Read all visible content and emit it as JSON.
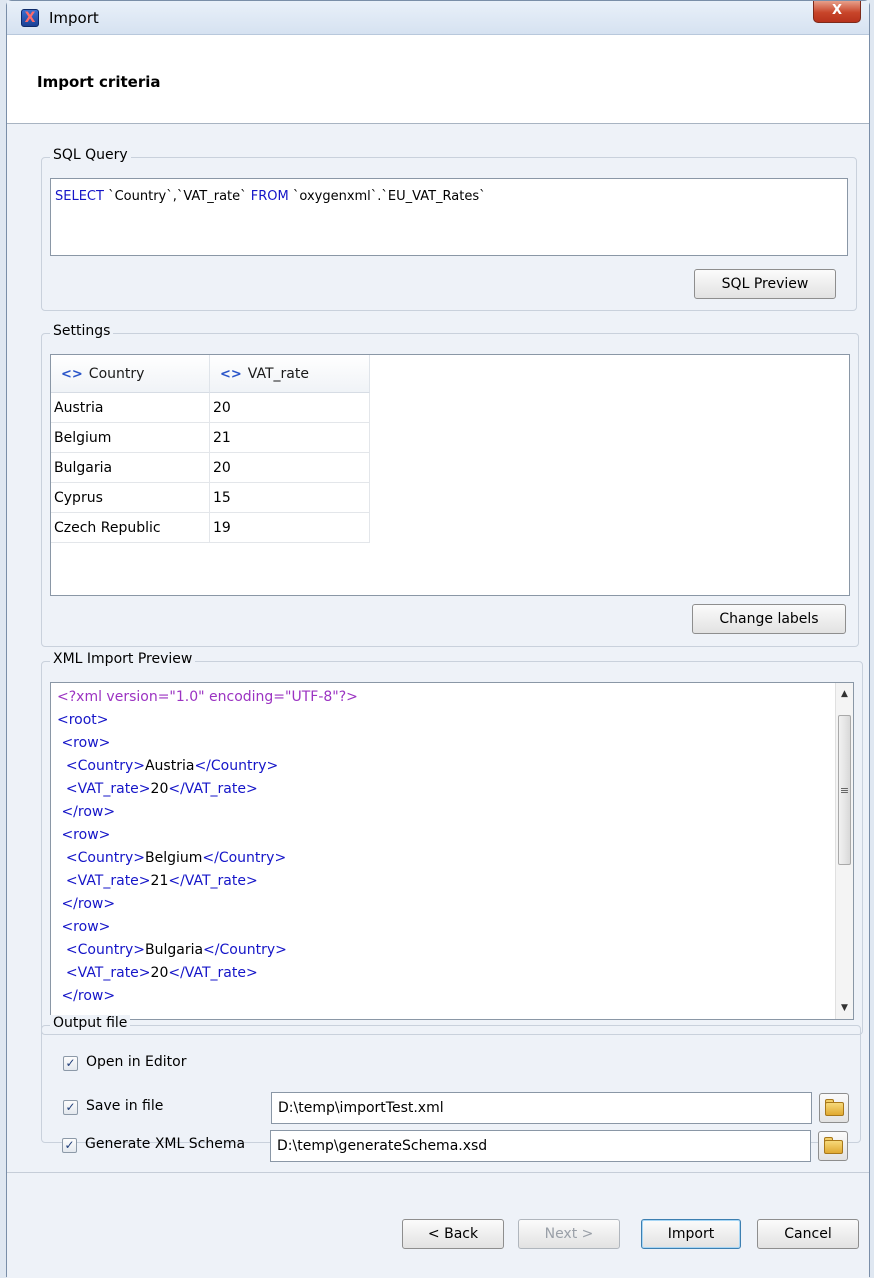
{
  "window": {
    "title": "Import",
    "close_glyph": "X"
  },
  "header": {
    "title": "Import criteria"
  },
  "sql_query": {
    "legend": "SQL Query",
    "query_parts": [
      "SELECT",
      " `Country`,`VAT_rate` ",
      "FROM",
      " `oxygenxml`.`EU_VAT_Rates`"
    ],
    "preview_button": "SQL Preview"
  },
  "settings": {
    "legend": "Settings",
    "columns": [
      "Country",
      "VAT_rate"
    ],
    "rows": [
      [
        "Austria",
        "20"
      ],
      [
        "Belgium",
        "21"
      ],
      [
        "Bulgaria",
        "20"
      ],
      [
        "Cyprus",
        "15"
      ],
      [
        "Czech Republic",
        "19"
      ]
    ],
    "change_labels_button": "Change labels"
  },
  "xml_preview": {
    "legend": "XML Import Preview",
    "lines": [
      {
        "indent": "",
        "tag_open": "",
        "text": "",
        "tag_close": "",
        "pi": "<?xml version=\"1.0\" encoding=\"UTF-8\"?>"
      },
      {
        "indent": "",
        "tag_open": "<root>",
        "text": "",
        "tag_close": ""
      },
      {
        "indent": " ",
        "tag_open": "<row>",
        "text": "",
        "tag_close": ""
      },
      {
        "indent": "  ",
        "tag_open": "<Country>",
        "text": "Austria",
        "tag_close": "</Country>"
      },
      {
        "indent": "  ",
        "tag_open": "<VAT_rate>",
        "text": "20",
        "tag_close": "</VAT_rate>"
      },
      {
        "indent": " ",
        "tag_open": "</row>",
        "text": "",
        "tag_close": ""
      },
      {
        "indent": " ",
        "tag_open": "<row>",
        "text": "",
        "tag_close": ""
      },
      {
        "indent": "  ",
        "tag_open": "<Country>",
        "text": "Belgium",
        "tag_close": "</Country>"
      },
      {
        "indent": "  ",
        "tag_open": "<VAT_rate>",
        "text": "21",
        "tag_close": "</VAT_rate>"
      },
      {
        "indent": " ",
        "tag_open": "</row>",
        "text": "",
        "tag_close": ""
      },
      {
        "indent": " ",
        "tag_open": "<row>",
        "text": "",
        "tag_close": ""
      },
      {
        "indent": "  ",
        "tag_open": "<Country>",
        "text": "Bulgaria",
        "tag_close": "</Country>"
      },
      {
        "indent": "  ",
        "tag_open": "<VAT_rate>",
        "text": "20",
        "tag_close": "</VAT_rate>"
      },
      {
        "indent": " ",
        "tag_open": "</row>",
        "text": "",
        "tag_close": ""
      }
    ]
  },
  "output_file": {
    "legend": "Output file",
    "open_in_editor": {
      "label": "Open in Editor",
      "checked": true
    },
    "save_in_file": {
      "label": "Save in file",
      "checked": true,
      "path": "D:\\temp\\importTest.xml"
    },
    "generate_schema": {
      "label": "Generate XML Schema",
      "checked": true,
      "path": "D:\\temp\\generateSchema.xsd"
    }
  },
  "footer": {
    "back": "< Back",
    "next": "Next >",
    "import": "Import",
    "cancel": "Cancel"
  }
}
